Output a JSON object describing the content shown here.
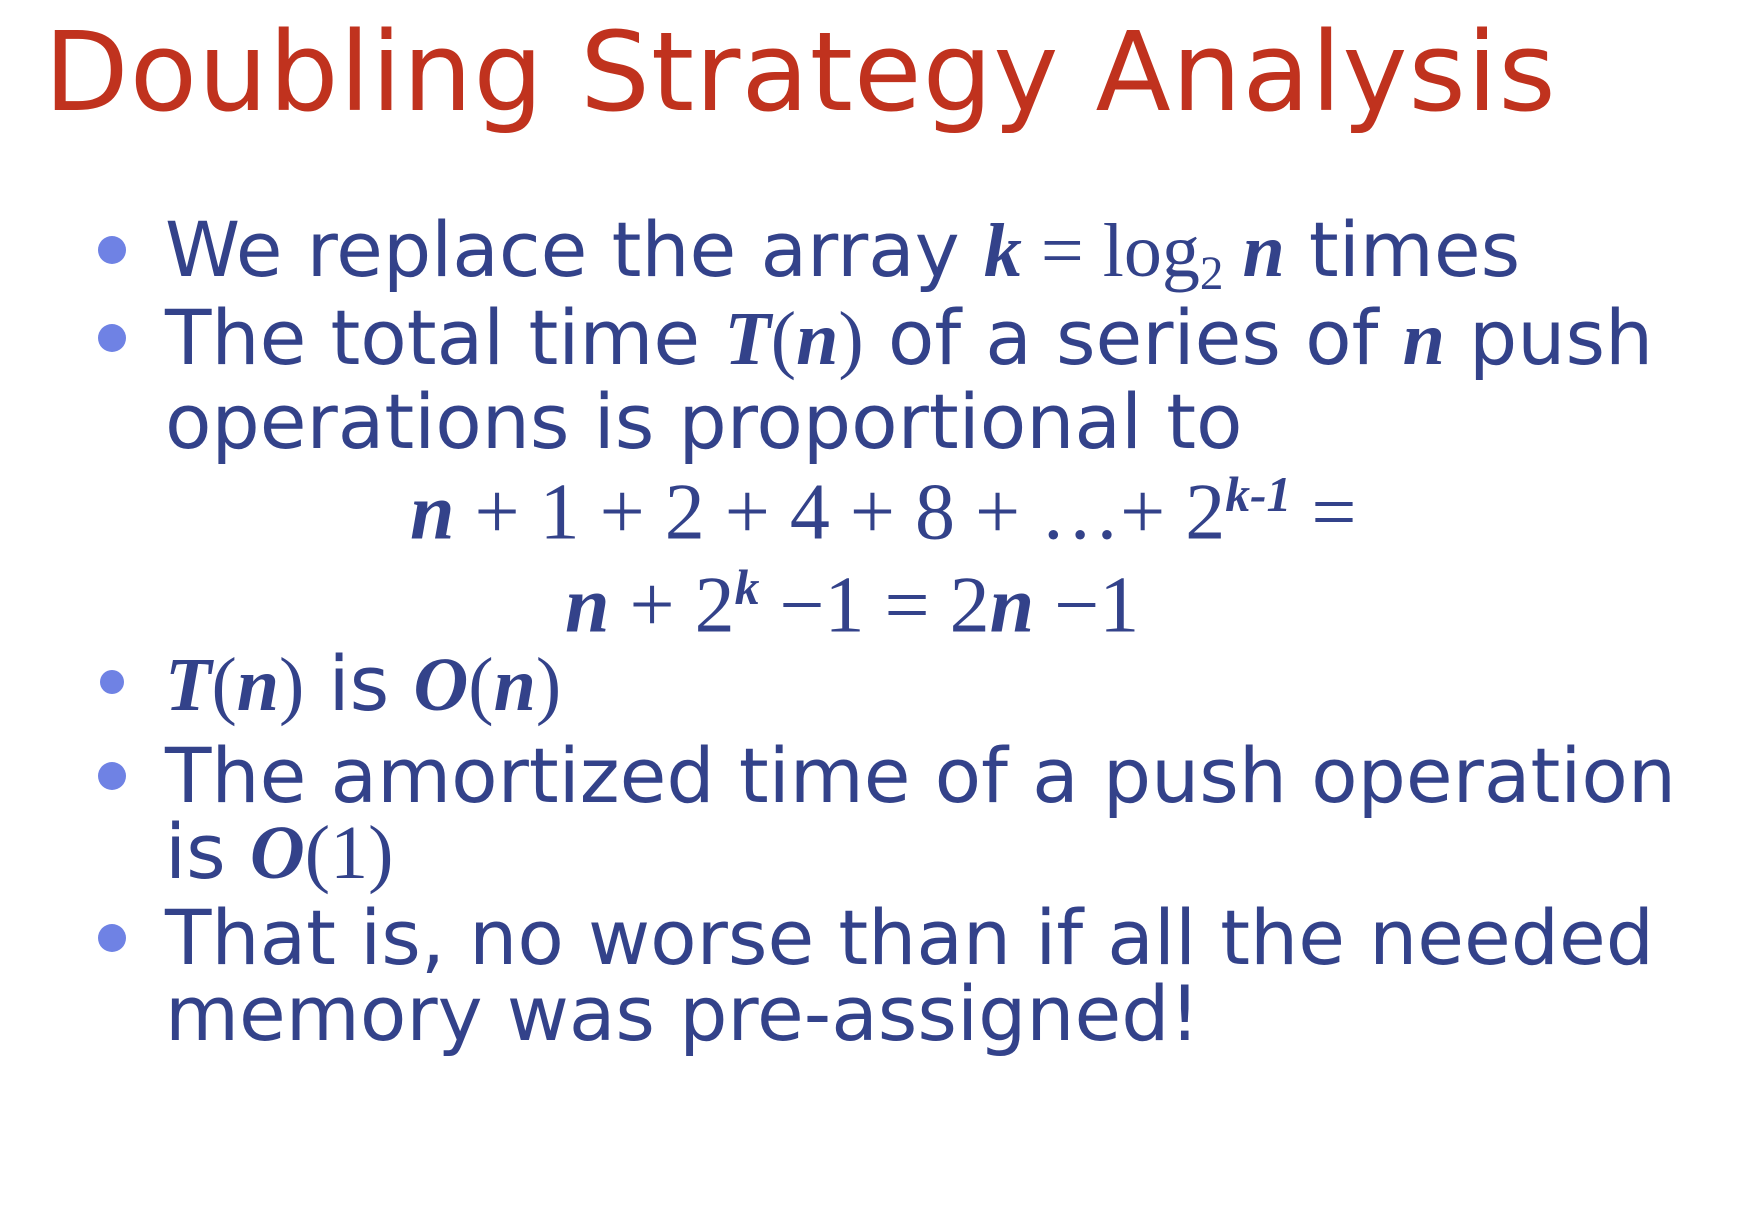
{
  "title": "Doubling Strategy Analysis",
  "bullets": [
    {
      "text_a": "We replace the array ",
      "math_k": "k",
      "math_eq": " = log",
      "math_base": "2",
      "math_n": " n",
      "text_b": " times"
    },
    {
      "text_a": "The total time ",
      "math_T": "T",
      "math_open": "(",
      "math_n": "n",
      "math_close": ")",
      "text_b": " of a series of ",
      "math_n2": "n",
      "text_c": " push",
      "line2": "operations is proportional to"
    },
    {
      "math_T": "T",
      "math_open": "(",
      "math_n": "n",
      "math_close": ")",
      "text_mid": " is ",
      "math_O": "O",
      "math_open2": "(",
      "math_n2": "n",
      "math_close2": ")"
    },
    {
      "line1": "The amortized time of a push operation",
      "text_is": "is ",
      "math_O": "O",
      "math_arg": "(1)"
    },
    {
      "line1": "That is, no worse than if all the needed",
      "line2": "memory was pre-assigned!"
    }
  ],
  "equations": {
    "eq1_n": "n",
    "eq1_rest": " + 1 + 2 + 4 + 8 + …+ 2",
    "eq1_exp": "k-1",
    "eq1_end": " =",
    "eq2_n": "n",
    "eq2_mid": " + 2",
    "eq2_exp": "k",
    "eq2_rest": " −1  = 2",
    "eq2_n2": "n",
    "eq2_end": " −1"
  }
}
